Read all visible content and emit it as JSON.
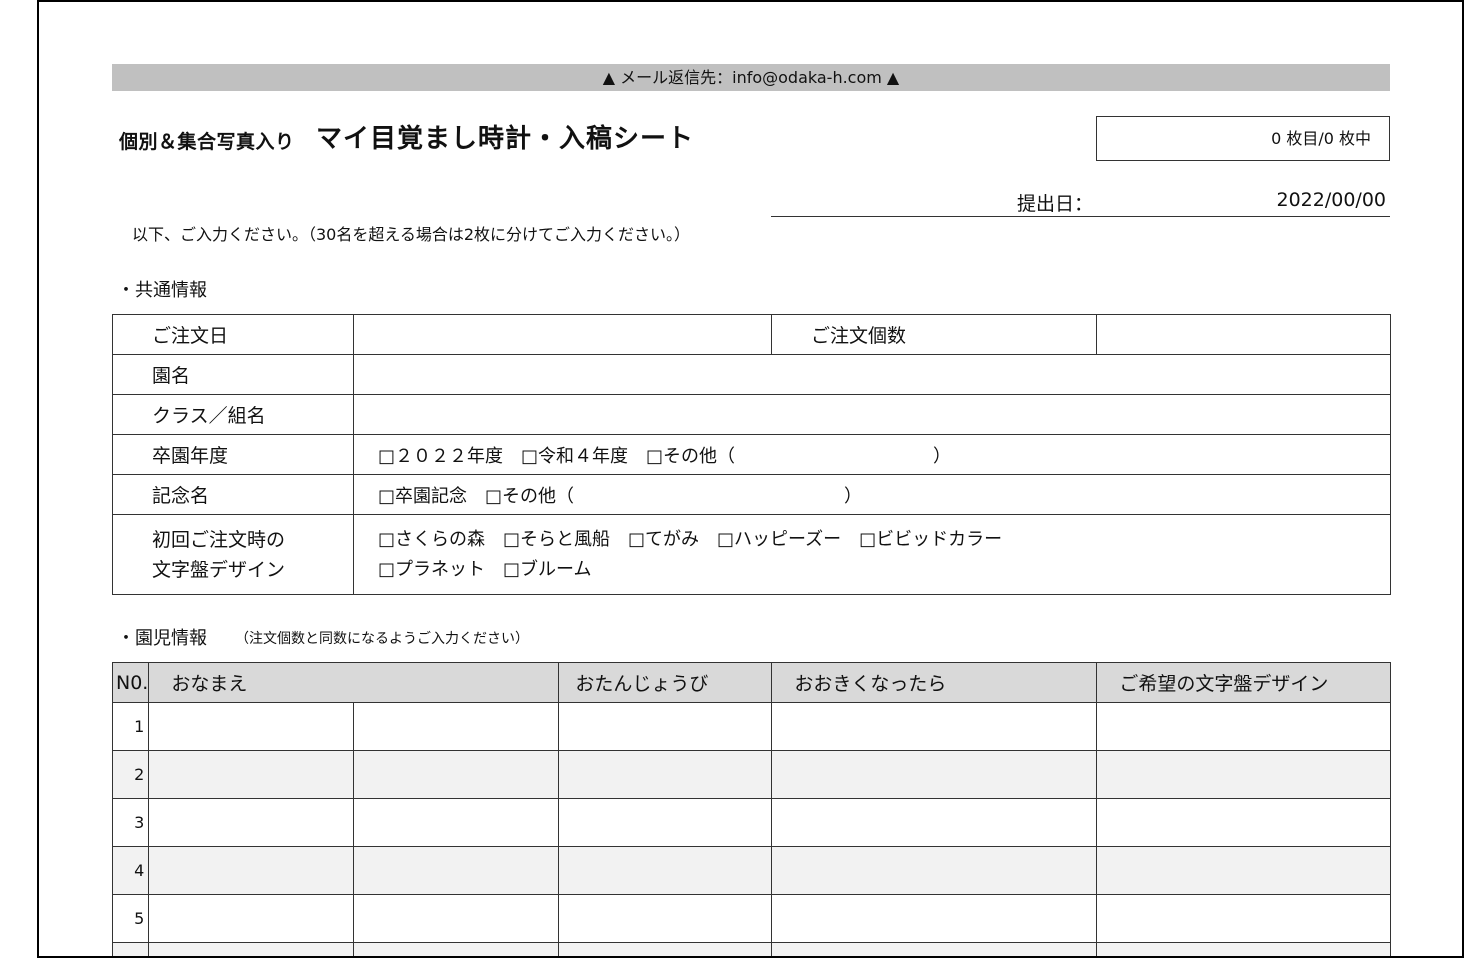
{
  "header": {
    "mail_bar": "▲ メール返信先：info@odaka-h.com ▲",
    "title_small": "個別＆集合写真入り",
    "title_big": "マイ目覚まし時計・入稿シート",
    "page_count": "0 枚目/0 枚中",
    "date_label": "提出日：",
    "date_value": "2022/00/00",
    "note": "以下、ご入力ください。（30名を超える場合は2枚に分けてご入力ください。）"
  },
  "common": {
    "section_title": "・共通情報",
    "order_date_label": "ご注文日",
    "order_qty_label": "ご注文個数",
    "kindergarten_label": "園名",
    "class_label": "クラス／組名",
    "grad_year_label": "卒園年度",
    "grad_year_options": "□２０２２年度　□令和４年度　□その他（　　　　　　　　　　　）",
    "memorial_label": "記念名",
    "memorial_options": "□卒園記念　□その他（　　　　　　　　　　　　　　　）",
    "design_label_line1": "初回ご注文時の",
    "design_label_line2": "文字盤デザイン",
    "design_options_line1": "□さくらの森　□そらと風船　□てがみ　□ハッピーズー　□ビビッドカラー",
    "design_options_line2": "□プラネット　□ブルーム"
  },
  "children": {
    "section_title": "・園児情報",
    "section_note": "（注文個数と同数になるようご入力ください）",
    "headers": {
      "no": "N0.",
      "name": "おなまえ",
      "birthday": "おたんじょうび",
      "dream": "おおきくなったら",
      "design": "ご希望の文字盤デザイン"
    },
    "rows": [
      "1",
      "2",
      "3",
      "4",
      "5",
      ""
    ]
  }
}
